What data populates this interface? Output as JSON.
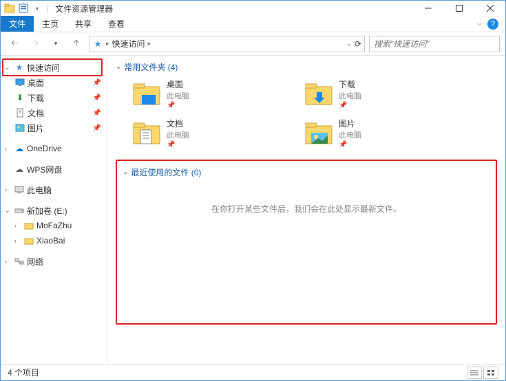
{
  "window": {
    "title": "文件资源管理器"
  },
  "ribbon": {
    "file": "文件",
    "tabs": [
      "主页",
      "共享",
      "查看"
    ]
  },
  "nav": {
    "crumb_root": "快速访问",
    "search_placeholder": "搜索\"快速访问\""
  },
  "sidebar": {
    "quick": "快速访问",
    "items": [
      {
        "label": "桌面"
      },
      {
        "label": "下载"
      },
      {
        "label": "文档"
      },
      {
        "label": "图片"
      }
    ],
    "onedrive": "OneDrive",
    "wps": "WPS网盘",
    "thispc": "此电脑",
    "drive": "新加卷 (E:)",
    "drive_items": [
      "MoFaZhu",
      "XiaoBai"
    ],
    "network": "网络"
  },
  "content": {
    "frequent_header": "常用文件夹 (4)",
    "sub_thispc": "此电脑",
    "folders": [
      {
        "name": "桌面"
      },
      {
        "name": "下载"
      },
      {
        "name": "文档"
      },
      {
        "name": "图片"
      }
    ],
    "recent_header": "最近使用的文件 (0)",
    "recent_empty": "在你打开某些文件后，我们会在此处显示最新文件。"
  },
  "statusbar": {
    "count": "4 个项目"
  }
}
